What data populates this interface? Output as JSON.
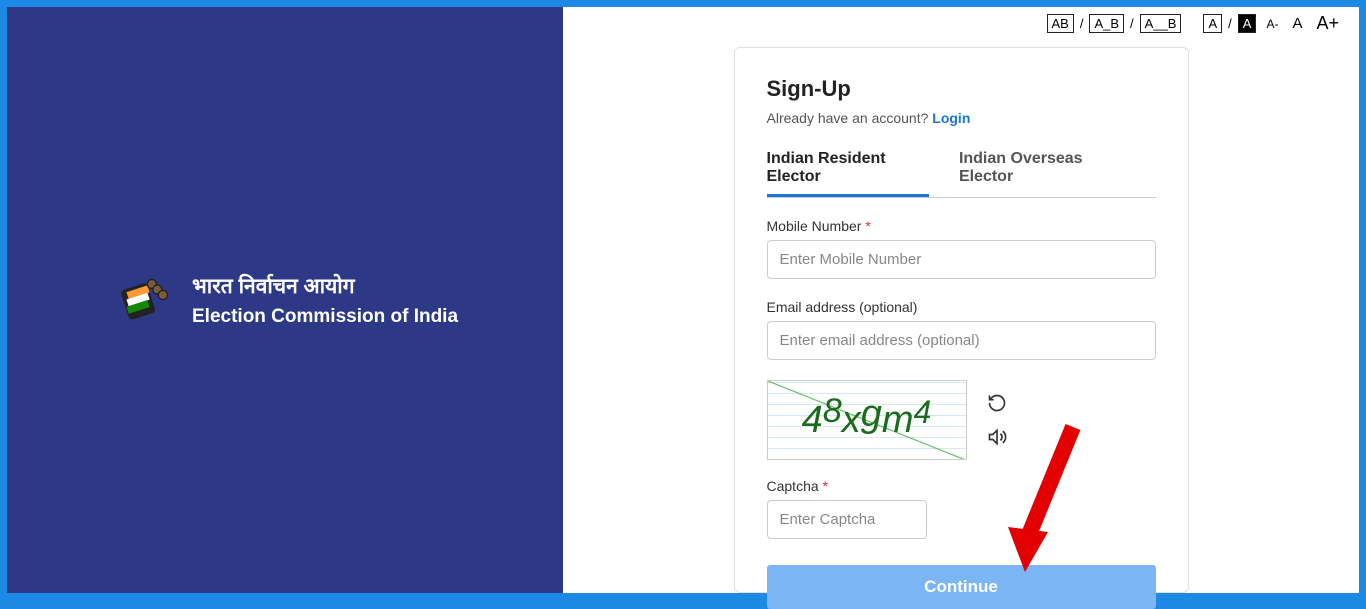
{
  "brand": {
    "title_hi": "भारत निर्वाचन आयोग",
    "title_en": "Election Commission of India"
  },
  "accessibility": {
    "ab": "AB",
    "a_b": "A_B",
    "a__b": "A__B",
    "a_light": "A",
    "a_dark": "A",
    "font_small": "A-",
    "font_med": "A",
    "font_big": "A+"
  },
  "card": {
    "title": "Sign-Up",
    "already_text": "Already have an account? ",
    "login_label": "Login",
    "tabs": {
      "resident": "Indian Resident Elector",
      "overseas": "Indian Overseas Elector"
    },
    "mobile": {
      "label": "Mobile Number ",
      "placeholder": "Enter Mobile Number"
    },
    "email": {
      "label": "Email address (optional)",
      "placeholder": "Enter email address (optional)"
    },
    "captcha": {
      "label": "Captcha ",
      "placeholder": "Enter Captcha",
      "glyphs": [
        "4",
        "8",
        "x",
        "g",
        "m",
        "4"
      ]
    },
    "continue_label": "Continue"
  }
}
